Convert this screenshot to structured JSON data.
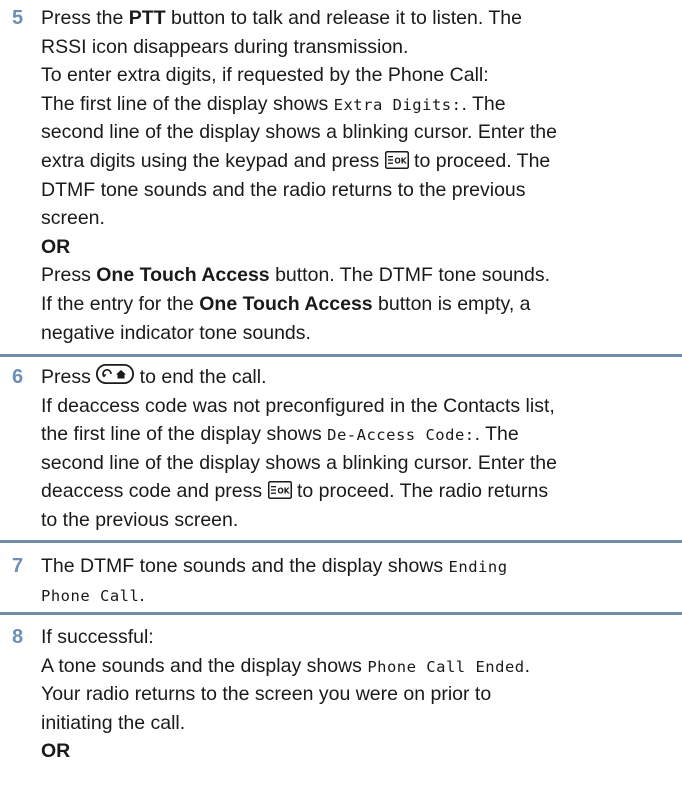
{
  "steps": [
    {
      "number": "5",
      "l1": {
        "a": "Press the ",
        "b": "PTT",
        "c": " button to talk and release it to listen. The"
      },
      "l2": "RSSI icon disappears during transmission.",
      "l3": "To enter extra digits, if requested by the Phone Call:",
      "l4": {
        "a": "The first line of the display shows ",
        "code": "Extra Digits:",
        "c": ". The"
      },
      "l5": "second line of the display shows a blinking cursor. Enter the",
      "l6": {
        "a": "extra digits using the keypad and press ",
        "key": "menu-ok-key",
        "c": " to proceed. The"
      },
      "l7": "DTMF tone sounds and the radio returns to the previous",
      "l8": "screen.",
      "or": "OR",
      "l10": {
        "a": "Press ",
        "b": "One Touch Access",
        "c": " button. The DTMF tone sounds."
      },
      "l11": {
        "a": "If the entry for the ",
        "b": "One Touch Access",
        "c": " button is empty, a"
      },
      "l12": "negative indicator tone sounds."
    },
    {
      "number": "6",
      "l1": {
        "a": "Press ",
        "key": "back-home-key",
        "c": " to end the call."
      },
      "l2": "If deaccess code was not preconfigured in the Contacts list,",
      "l3": {
        "a": "the first line of the display shows ",
        "code": "De-Access Code:",
        "c": ". The"
      },
      "l4": "second line of the display shows a blinking cursor. Enter the",
      "l5": {
        "a": "deaccess code and press ",
        "key": "menu-ok-key",
        "c": " to proceed. The radio returns"
      },
      "l6": "to the previous screen."
    },
    {
      "number": "7",
      "l1": {
        "a": "The DTMF tone sounds and the display shows ",
        "code": "Ending"
      },
      "l2": {
        "code": "Phone Call",
        "c": "."
      }
    },
    {
      "number": "8",
      "l1": "If successful:",
      "l2": {
        "a": "A tone sounds and the display shows ",
        "code": "Phone Call Ended",
        "c": "."
      },
      "l3": "Your radio returns to the screen you were on prior to",
      "l4": "initiating the call.",
      "or": "OR"
    }
  ],
  "colors": {
    "step_number": "#6d8fb1",
    "separator": "#6f8ca9"
  }
}
